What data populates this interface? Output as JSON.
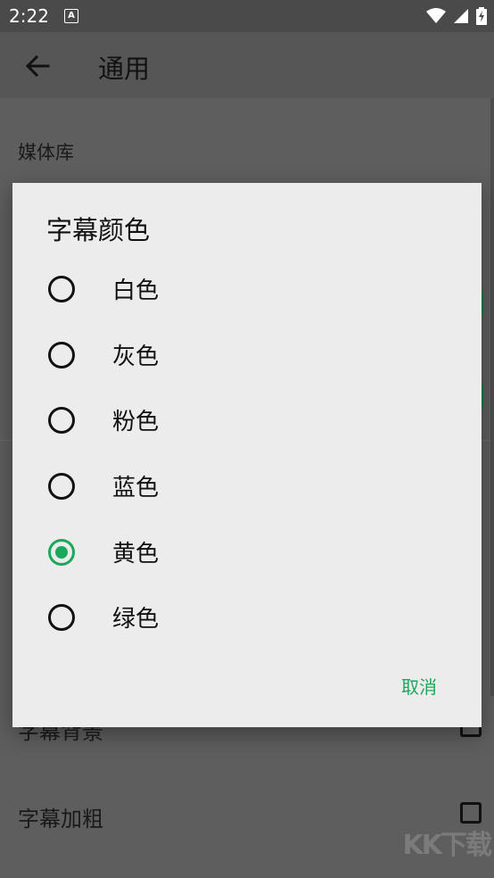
{
  "status_bar": {
    "time": "2:22",
    "notification_icon_letter": "A"
  },
  "app_bar": {
    "title": "通用"
  },
  "background": {
    "section_header": "媒体库",
    "rows": [
      {
        "label": "字幕背景"
      },
      {
        "label": "字幕加粗"
      }
    ]
  },
  "dialog": {
    "title": "字幕颜色",
    "options": [
      {
        "label": "白色",
        "selected": false
      },
      {
        "label": "灰色",
        "selected": false
      },
      {
        "label": "粉色",
        "selected": false
      },
      {
        "label": "蓝色",
        "selected": false
      },
      {
        "label": "黄色",
        "selected": true
      },
      {
        "label": "绿色",
        "selected": false
      }
    ],
    "cancel_label": "取消"
  },
  "watermark": "KK下载",
  "colors": {
    "accent": "#1aa85a",
    "dialog_bg": "#ececec",
    "scrim": "#5f5f5f"
  }
}
